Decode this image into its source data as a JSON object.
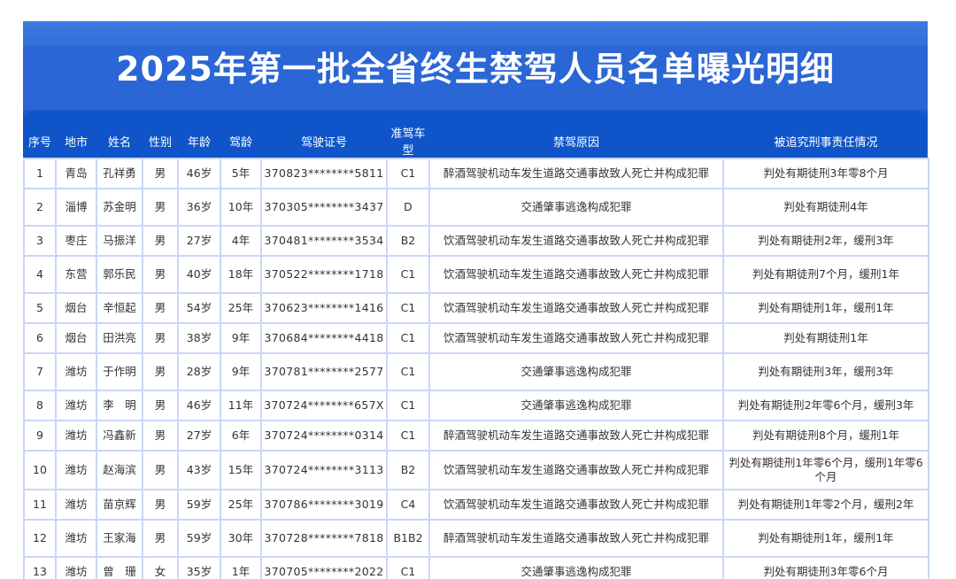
{
  "title": "2025年第一批全省终生禁驾人员名单曝光明细",
  "columns": [
    "序号",
    "地市",
    "姓名",
    "性别",
    "年龄",
    "驾龄",
    "驾驶证号",
    "准驾车型",
    "禁驾原因",
    "被追究刑事责任情况"
  ],
  "rows": [
    [
      "1",
      "青岛",
      "孔祥勇",
      "男",
      "46岁",
      "5年",
      "370823********5811",
      "C1",
      "醉酒驾驶机动车发生道路交通事故致人死亡并构成犯罪",
      "判处有期徒刑3年零8个月"
    ],
    [
      "2",
      "淄博",
      "苏金明",
      "男",
      "36岁",
      "10年",
      "370305********3437",
      "D",
      "交通肇事逃逸构成犯罪",
      "判处有期徒刑4年"
    ],
    [
      "3",
      "枣庄",
      "马振洋",
      "男",
      "27岁",
      "4年",
      "370481********3534",
      "B2",
      "饮酒驾驶机动车发生道路交通事故致人死亡并构成犯罪",
      "判处有期徒刑2年，缓刑3年"
    ],
    [
      "4",
      "东营",
      "郭乐民",
      "男",
      "40岁",
      "18年",
      "370522********1718",
      "C1",
      "饮酒驾驶机动车发生道路交通事故致人死亡并构成犯罪",
      "判处有期徒刑7个月，缓刑1年"
    ],
    [
      "5",
      "烟台",
      "辛恒起",
      "男",
      "54岁",
      "25年",
      "370623********1416",
      "C1",
      "饮酒驾驶机动车发生道路交通事故致人死亡并构成犯罪",
      "判处有期徒刑1年，缓刑1年"
    ],
    [
      "6",
      "烟台",
      "田洪亮",
      "男",
      "38岁",
      "9年",
      "370684********4418",
      "C1",
      "饮酒驾驶机动车发生道路交通事故致人死亡并构成犯罪",
      "判处有期徒刑1年"
    ],
    [
      "7",
      "潍坊",
      "于作明",
      "男",
      "28岁",
      "9年",
      "370781********2577",
      "C1",
      "交通肇事逃逸构成犯罪",
      "判处有期徒刑3年，缓刑3年"
    ],
    [
      "8",
      "潍坊",
      "李　明",
      "男",
      "46岁",
      "11年",
      "370724********657X",
      "C1",
      "交通肇事逃逸构成犯罪",
      "判处有期徒刑2年零6个月，缓刑3年"
    ],
    [
      "9",
      "潍坊",
      "冯鑫新",
      "男",
      "27岁",
      "6年",
      "370724********0314",
      "C1",
      "醉酒驾驶机动车发生道路交通事故致人死亡并构成犯罪",
      "判处有期徒刑8个月，缓刑1年"
    ],
    [
      "10",
      "潍坊",
      "赵海滨",
      "男",
      "43岁",
      "15年",
      "370724********3113",
      "B2",
      "饮酒驾驶机动车发生道路交通事故致人死亡并构成犯罪",
      "判处有期徒刑1年零6个月，缓刑1年零6个月"
    ],
    [
      "11",
      "潍坊",
      "苗京辉",
      "男",
      "59岁",
      "25年",
      "370786********3019",
      "C4",
      "饮酒驾驶机动车发生道路交通事故致人死亡并构成犯罪",
      "判处有期徒刑1年零2个月，缓刑2年"
    ],
    [
      "12",
      "潍坊",
      "王家海",
      "男",
      "59岁",
      "30年",
      "370728********7818",
      "B1B2",
      "醉酒驾驶机动车发生道路交通事故致人死亡并构成犯罪",
      "判处有期徒刑1年，缓刑1年"
    ],
    [
      "13",
      "潍坊",
      "曾　珊",
      "女",
      "35岁",
      "1年",
      "370705********2022",
      "C1",
      "交通肇事逃逸构成犯罪",
      "判处有期徒刑3年零6个月"
    ]
  ],
  "colors": {
    "frame": "#0f55c9",
    "title_band": "#2a66d5",
    "cell_border": "#c9d6f7",
    "cell_text": "#333333",
    "header_text": "#ffffff"
  }
}
